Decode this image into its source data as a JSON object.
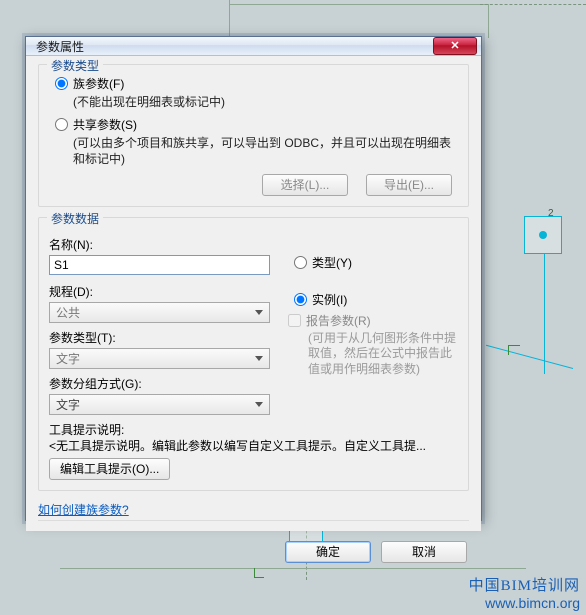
{
  "dialog": {
    "title": "参数属性"
  },
  "groups": {
    "param_type": {
      "title": "参数类型",
      "family": {
        "label": "族参数(F)",
        "desc": "(不能出现在明细表或标记中)"
      },
      "shared": {
        "label": "共享参数(S)",
        "desc": "(可以由多个项目和族共享，可以导出到 ODBC，并且可以出现在明细表和标记中)"
      },
      "buttons": {
        "select": "选择(L)...",
        "export": "导出(E)..."
      }
    },
    "param_data": {
      "title": "参数数据",
      "name": {
        "label": "名称(N):",
        "value": "S1"
      },
      "discipline": {
        "label": "规程(D):",
        "value": "公共"
      },
      "ptype": {
        "label": "参数类型(T):",
        "value": "文字"
      },
      "groupby": {
        "label": "参数分组方式(G):",
        "value": "文字"
      },
      "type_instance": {
        "type": "类型(Y)",
        "instance": "实例(I)"
      },
      "report": {
        "label": "报告参数(R)",
        "note": "(可用于从几何图形条件中提取值，然后在公式中报告此值或用作明细表参数)"
      },
      "tooltip": {
        "label": "工具提示说明:",
        "text": "<无工具提示说明。编辑此参数以编写自定义工具提示。自定义工具提...",
        "button": "编辑工具提示(O)..."
      }
    }
  },
  "link": "如何创建族参数?",
  "footer": {
    "ok": "确定",
    "cancel": "取消"
  },
  "watermark": {
    "line1": "中国BIM培训网",
    "line2": "www.bimcn.org"
  }
}
